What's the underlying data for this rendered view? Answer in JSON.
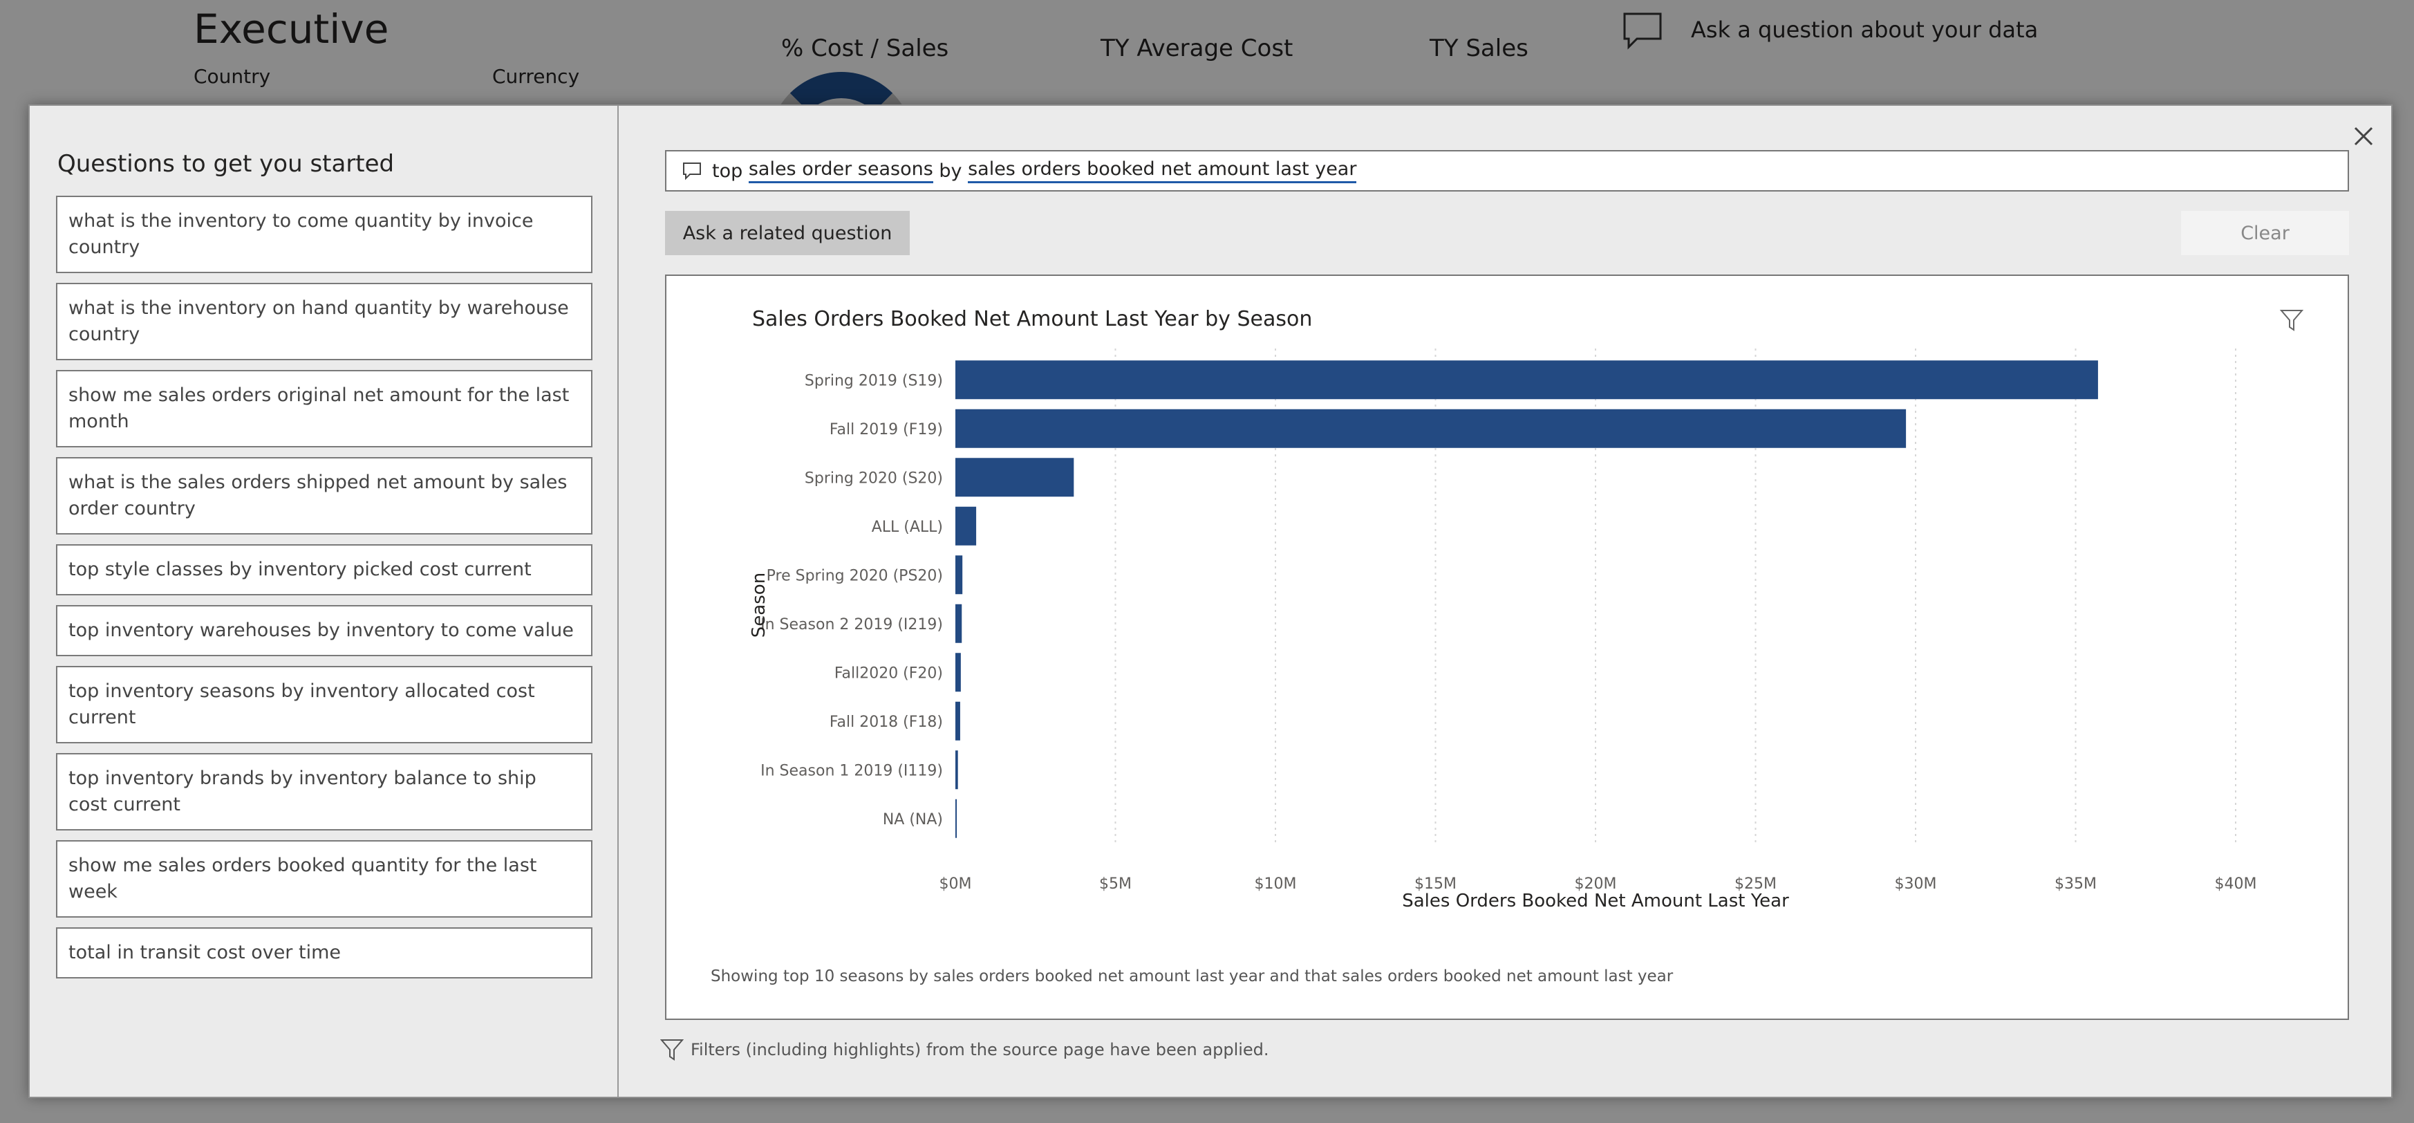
{
  "background": {
    "title": "Executive",
    "country_label": "Country",
    "currency_label": "Currency",
    "kpis": [
      "% Cost / Sales",
      "TY Average Cost",
      "TY Sales"
    ],
    "qa_placeholder": "Ask a question about your data"
  },
  "left_pane": {
    "heading": "Questions to get you started",
    "questions": [
      "what is the inventory to come quantity by invoice country",
      "what is the inventory on hand quantity by warehouse country",
      "show me sales orders original net amount for the last month",
      "what is the sales orders shipped net amount by sales order country",
      "top style classes by inventory picked cost current",
      "top inventory warehouses by inventory to come value",
      "top inventory seasons by inventory allocated cost current",
      "top inventory brands by inventory balance to ship cost current",
      "show me sales orders booked quantity for the last week",
      "total in transit cost over time"
    ]
  },
  "query": {
    "parts": [
      {
        "text": "top ",
        "underline": false
      },
      {
        "text": "sales order seasons",
        "underline": true
      },
      {
        "text": " by ",
        "underline": false
      },
      {
        "text": "sales orders booked net amount last year",
        "underline": true
      }
    ]
  },
  "buttons": {
    "related": "Ask a related question",
    "clear": "Clear"
  },
  "footnote": "Showing top 10 seasons by sales orders booked net amount last year and that sales orders booked net amount last year",
  "filter_note": "Filters (including highlights) from the source page have been applied.",
  "colors": {
    "bar": "#234a82",
    "underline": "#1f5aa8"
  },
  "chart_data": {
    "type": "bar",
    "orientation": "horizontal",
    "title": "Sales Orders Booked Net Amount Last Year by Season",
    "xlabel": "Sales Orders Booked Net Amount Last Year",
    "ylabel": "Season",
    "categories": [
      "Spring 2019 (S19)",
      "Fall 2019 (F19)",
      "Spring 2020 (S20)",
      "ALL (ALL)",
      "Pre Spring 2020 (PS20)",
      "In Season 2 2019 (I219)",
      "Fall2020 (F20)",
      "Fall 2018 (F18)",
      "In Season 1 2019 (I119)",
      "NA (NA)"
    ],
    "values": [
      35700000,
      29700000,
      3700000,
      650000,
      220000,
      200000,
      170000,
      150000,
      80000,
      40000
    ],
    "xlim": [
      0,
      40000000
    ],
    "xticks": [
      0,
      5000000,
      10000000,
      15000000,
      20000000,
      25000000,
      30000000,
      35000000,
      40000000
    ],
    "xtick_labels": [
      "$0M",
      "$5M",
      "$10M",
      "$15M",
      "$20M",
      "$25M",
      "$30M",
      "$35M",
      "$40M"
    ],
    "grid": "vertical dotted"
  }
}
